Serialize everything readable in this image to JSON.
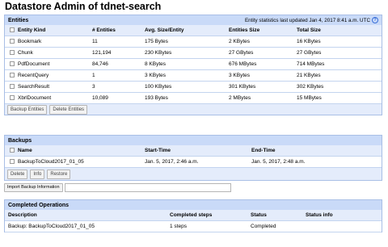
{
  "page": {
    "title": "Datastore Admin of tdnet-search"
  },
  "entities": {
    "heading": "Entities",
    "stats_note": "Entity statistics last updated Jan 4, 2017 8:41 a.m. UTC",
    "columns": [
      "Entity Kind",
      "# Entities",
      "Avg. Size/Entity",
      "Entities Size",
      "Total Size"
    ],
    "rows": [
      [
        "Bookmark",
        "11",
        "175 Bytes",
        "2 KBytes",
        "16 KBytes"
      ],
      [
        "Chunk",
        "121,194",
        "230 KBytes",
        "27 GBytes",
        "27 GBytes"
      ],
      [
        "PdfDocument",
        "84,746",
        "8 KBytes",
        "676 MBytes",
        "714 MBytes"
      ],
      [
        "RecentQuery",
        "1",
        "3 KBytes",
        "3 KBytes",
        "21 KBytes"
      ],
      [
        "SearchResult",
        "3",
        "100 KBytes",
        "301 KBytes",
        "302 KBytes"
      ],
      [
        "XbrlDocument",
        "10,089",
        "193 Bytes",
        "2 MBytes",
        "15 MBytes"
      ]
    ],
    "buttons": {
      "backup": "Backup Entities",
      "delete": "Delete Entities"
    }
  },
  "backups": {
    "heading": "Backups",
    "columns": [
      "Name",
      "Start-Time",
      "End-Time"
    ],
    "rows": [
      [
        "BackupToCloud2017_01_05",
        "Jan. 5, 2017, 2:46 a.m.",
        "Jan. 5, 2017, 2:48 a.m."
      ]
    ],
    "buttons": {
      "delete": "Delete",
      "info": "Info",
      "restore": "Restore"
    },
    "import_label": "Import Backup Information",
    "import_value": ""
  },
  "completed": {
    "heading": "Completed Operations",
    "columns": [
      "Description",
      "Completed steps",
      "Status",
      "Status info"
    ],
    "rows": [
      [
        "Backup: BackupToCloud2017_01_05",
        "1 steps",
        "Completed",
        ""
      ]
    ]
  },
  "colors": {
    "section_header": "#c9daf8",
    "row_header": "#e4ecfb",
    "border": "#a9bfe6"
  }
}
